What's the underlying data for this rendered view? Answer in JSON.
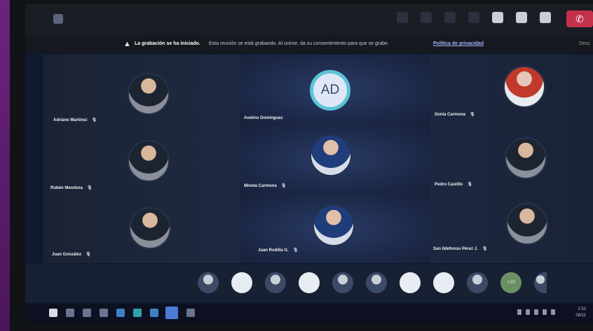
{
  "window": {
    "title": ""
  },
  "toolbar": {
    "icons": [
      "people-icon",
      "chat-icon",
      "hand-icon",
      "more-icon",
      "camera-icon",
      "mic-icon",
      "share-icon"
    ],
    "leave_label": "✆"
  },
  "banner": {
    "warning_icon": "▲",
    "strong": "La grabación se ha iniciado.",
    "text": "Esta reunión se está grabando. Al unirse, da su consentimiento para que se grabe.",
    "link": "Política de privacidad",
    "right": "Desc"
  },
  "participants": [
    {
      "name": "Adriano Martínez",
      "avatar": "photo"
    },
    {
      "name": "Avelino Domínguez",
      "avatar": "initials",
      "initials": "AD"
    },
    {
      "name": "Sonia Carmona",
      "avatar": "photo"
    },
    {
      "name": "Rubén Mendoza",
      "avatar": "photo"
    },
    {
      "name": "Mineta Carmona",
      "avatar": "photo"
    },
    {
      "name": "Pedro Castillo",
      "avatar": "photo"
    },
    {
      "name": "Juan González",
      "avatar": "photo"
    },
    {
      "name": "Juan Rodilla G.",
      "avatar": "photo"
    },
    {
      "name": "San Ildefonso Pérez J.",
      "avatar": "photo"
    }
  ],
  "mic_glyph": "🎙",
  "strip": {
    "overflow_label": "+10"
  },
  "taskbar": {
    "clock_time": "2:53",
    "clock_date": "08/11"
  },
  "colors": {
    "accent_ring": "#5cc3d8",
    "leave_red": "#c4314b"
  }
}
